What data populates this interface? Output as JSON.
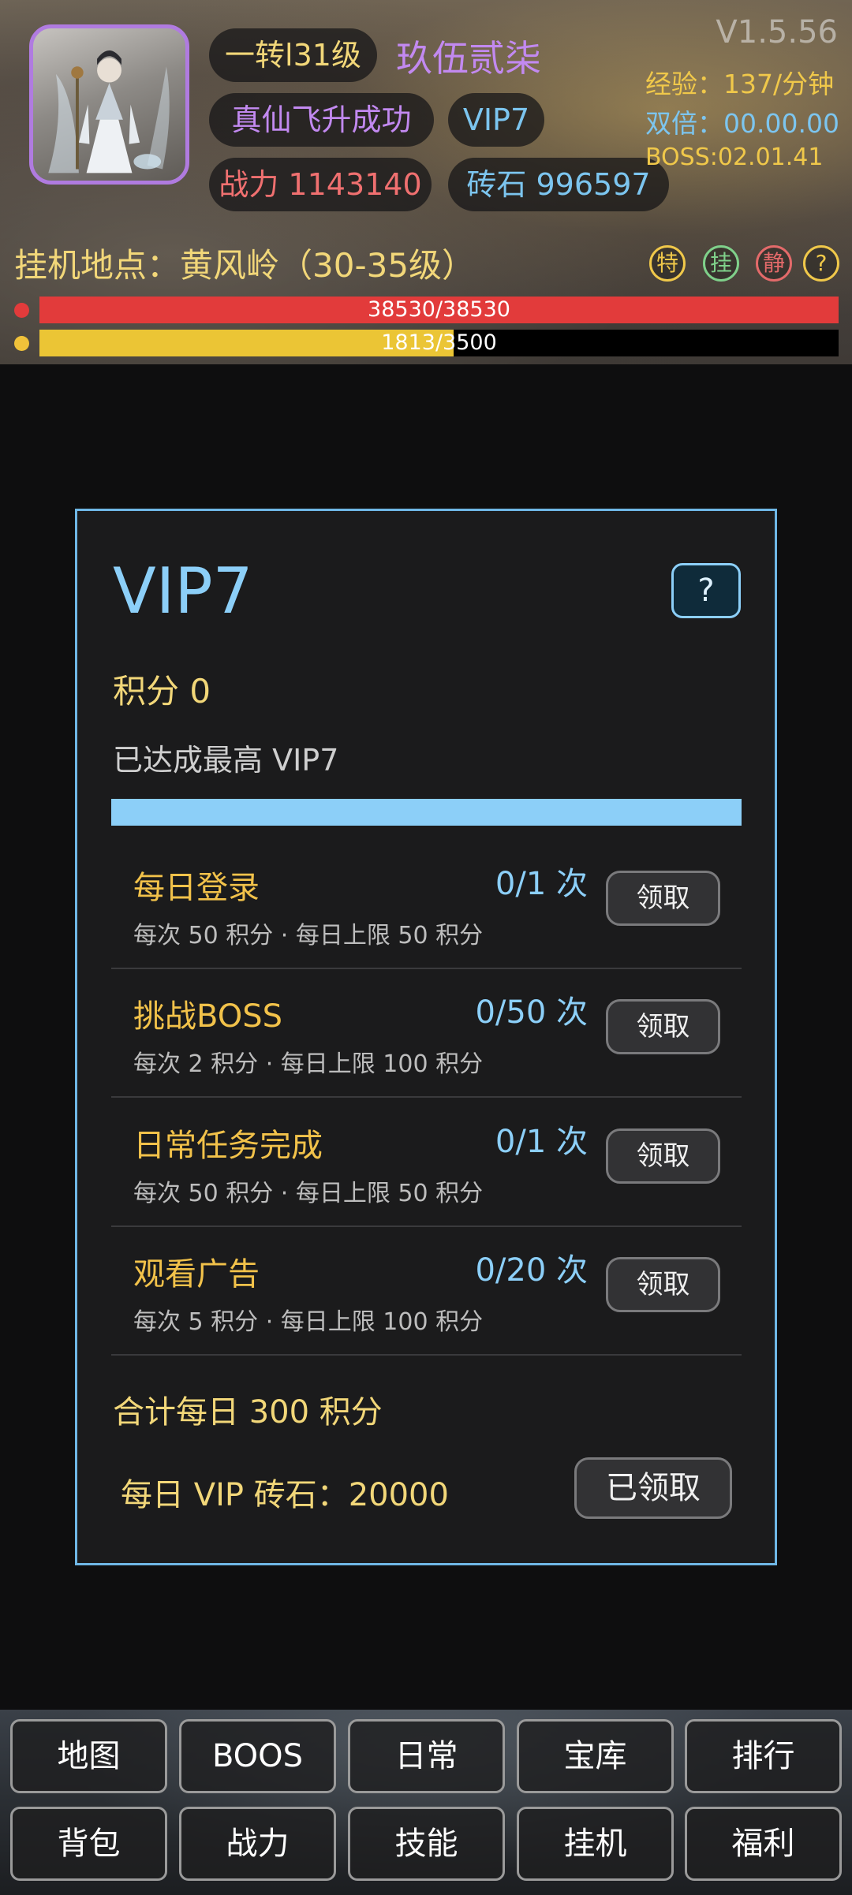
{
  "header": {
    "rebirth_level": "一转l31级",
    "player_name": "玖伍贰柒",
    "ascension": "真仙飞升成功",
    "vip_badge": "VIP7",
    "combat_power": "战力 1143140",
    "gems": "砖石 996597",
    "version": "V1.5.56",
    "exp_rate": "经验：137/分钟",
    "double_timer": "双倍：00.00.00",
    "boss_timer": "BOSS:02.01.41",
    "location": "挂机地点：黄风岭（30-35级）",
    "icons": {
      "special": "特",
      "idle": "挂",
      "quiet": "静",
      "help": "?"
    },
    "hp_text": "38530/38530",
    "hp_fraction": 1.0,
    "mp_text": "1813/3500",
    "mp_fraction": 0.518
  },
  "panel": {
    "title": "VIP7",
    "help_label": "?",
    "points": "积分 0",
    "status": "已达成最高 VIP7",
    "progress_fraction": 1.0,
    "tasks": [
      {
        "name": "每日登录",
        "count": "0/1 次",
        "desc": "每次 50 积分 · 每日上限 50 积分",
        "button": "领取"
      },
      {
        "name": "挑战BOSS",
        "count": "0/50 次",
        "desc": "每次 2 积分 · 每日上限 100 积分",
        "button": "领取"
      },
      {
        "name": "日常任务完成",
        "count": "0/1 次",
        "desc": "每次 50 积分 · 每日上限 50 积分",
        "button": "领取"
      },
      {
        "name": "观看广告",
        "count": "0/20 次",
        "desc": "每次 5 积分 · 每日上限 100 积分",
        "button": "领取"
      }
    ],
    "daily_total": "合计每日 300 积分",
    "vip_gems": "每日 VIP 砖石：20000",
    "claimed_label": "已领取"
  },
  "nav": {
    "row1": [
      "地图",
      "BOOS",
      "日常",
      "宝库",
      "排行"
    ],
    "row2": [
      "背包",
      "战力",
      "技能",
      "挂机",
      "福利"
    ]
  },
  "colors": {
    "panel_border": "#6fb7e6",
    "vip_blue": "#8ccff8",
    "gold": "#f2d779",
    "purple": "#c289f0",
    "hp_red": "#e23b3b",
    "mp_yellow": "#ebc535"
  }
}
